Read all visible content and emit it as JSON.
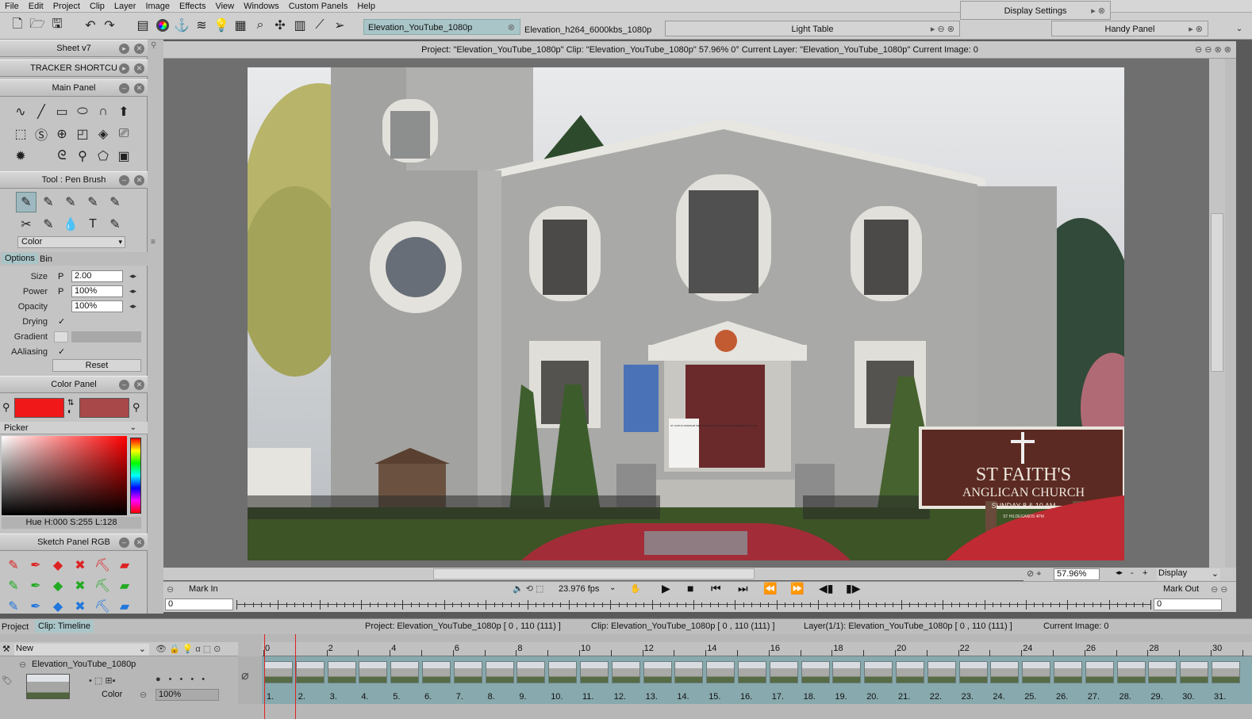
{
  "menu": [
    "File",
    "Edit",
    "Project",
    "Clip",
    "Layer",
    "Image",
    "Effects",
    "View",
    "Windows",
    "Custom Panels",
    "Help"
  ],
  "tabs": {
    "doc1": "Elevation_YouTube_1080p",
    "doc2": "Elevation_h264_6000kbs_1080p",
    "light_table": "Light Table",
    "display_settings": "Display Settings",
    "handy_panel": "Handy Panel"
  },
  "panels": {
    "sheet": "Sheet v7",
    "tracker": "TRACKER SHORTCU",
    "main": "Main Panel",
    "tool": "Tool : Pen Brush",
    "color_panel": "Color Panel",
    "sketch": "Sketch Panel RGB"
  },
  "tool": {
    "color_select": "Color",
    "tab_options": "Options",
    "tab_bin": "Bin",
    "size_label": "Size",
    "size_value": "2.00",
    "power_label": "Power",
    "power_value": "100%",
    "opacity_label": "Opacity",
    "opacity_value": "100%",
    "drying_label": "Drying",
    "gradient_label": "Gradient",
    "aaliasing_label": "AAliasing",
    "p": "P",
    "reset": "Reset",
    "check": "✓"
  },
  "color": {
    "primary": "#f01818",
    "secondary": "#a84848",
    "picker_label": "Picker",
    "hsl": "Hue H:000 S:255 L:128"
  },
  "viewer": {
    "title": "Project:  \"Elevation_YouTube_1080p\"  Clip: \"Elevation_YouTube_1080p\"   57.96%   0°  Current Layer: \"Elevation_YouTube_1080p\"  Current Image: 0",
    "zoom": "57.96%",
    "display": "Display",
    "fps": "23.976 fps",
    "mark_in": "Mark In",
    "mark_out": "Mark Out",
    "in_value": "0",
    "out_value": "0",
    "plus": "+",
    "minus": "-"
  },
  "photo": {
    "sign_line1": "ST FAITH'S",
    "sign_line2": "ANGLICAN CHURCH",
    "sign_line3": "SUNDAY 8 & 10 AM",
    "sign_line4": "ST HILDEGARDS 4PM",
    "notice": "ST. FAITH'S WORSHIP WED 10 AM SUN 8 & 10 AM ST HILDEGARD SUN 4 PM"
  },
  "timeline": {
    "tab_project": "Project",
    "tab_clip": "Clip: Timeline",
    "project_info": "Project: Elevation_YouTube_1080p [ 0 , 110  (111) ]",
    "clip_info": "Clip: Elevation_YouTube_1080p [ 0 , 110  (111) ]",
    "layer_info": "Layer(1/1): Elevation_YouTube_1080p [ 0 , 110  (111) ]",
    "current_image": "Current Image: 0",
    "new_label": "New",
    "layer_name": "Elevation_YouTube_1080p",
    "color_label": "Color",
    "opacity": "100%",
    "ruler": [
      "0",
      "2",
      "4",
      "6",
      "8",
      "10",
      "12",
      "14",
      "16",
      "18",
      "20",
      "22",
      "24",
      "26",
      "28",
      "30"
    ],
    "frames": [
      "1.",
      "2.",
      "3.",
      "4.",
      "5.",
      "6.",
      "7.",
      "8.",
      "9.",
      "10.",
      "11.",
      "12.",
      "13.",
      "14.",
      "15.",
      "16.",
      "17.",
      "18.",
      "19.",
      "20.",
      "21.",
      "22.",
      "23.",
      "24.",
      "25.",
      "26.",
      "27.",
      "28.",
      "29.",
      "30.",
      "31."
    ]
  }
}
